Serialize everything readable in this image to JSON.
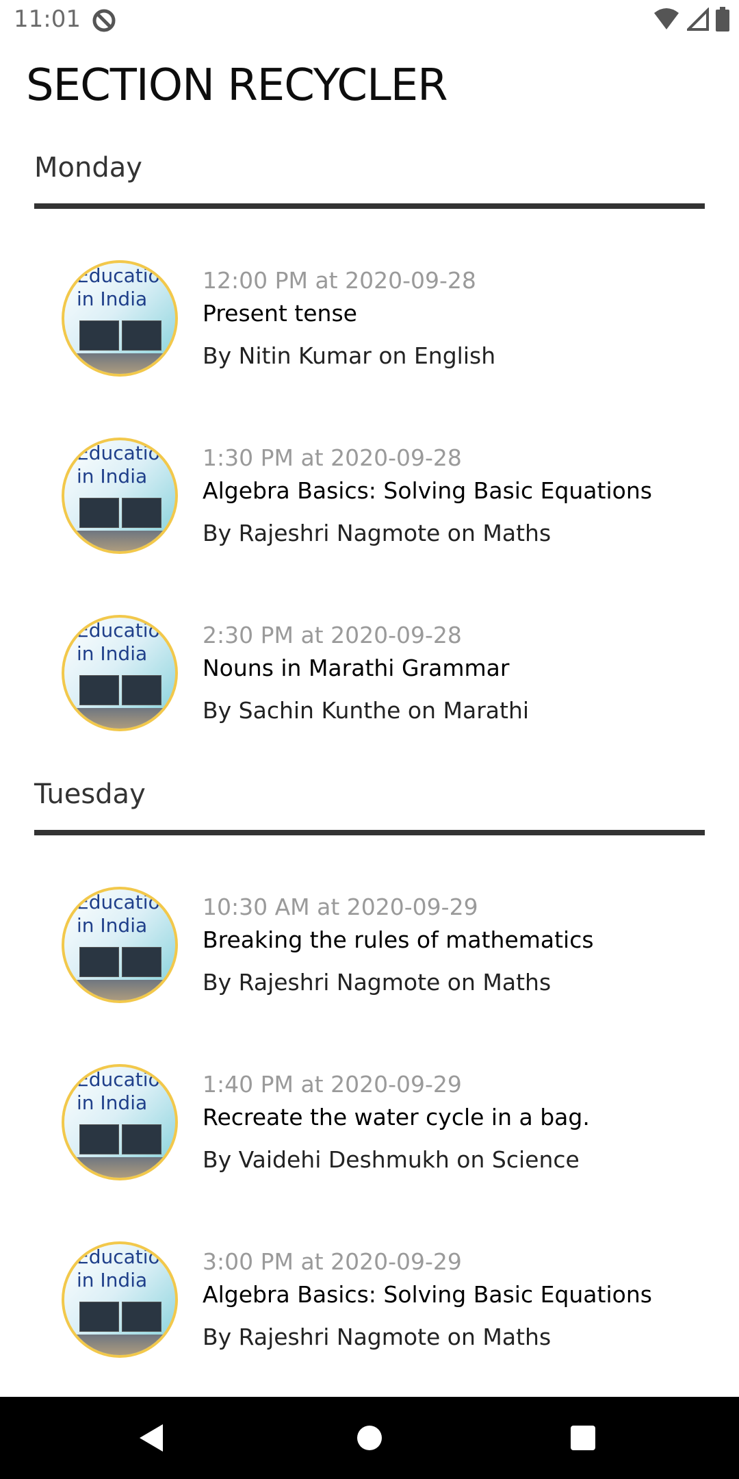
{
  "status_bar": {
    "time": "11:01"
  },
  "page": {
    "title": "SECTION RECYCLER"
  },
  "thumbnail": {
    "line1": "Educatio",
    "line2": "in India"
  },
  "sections": [
    {
      "header": "Monday",
      "items": [
        {
          "time": "12:00 PM at 2020-09-28",
          "title": "Present tense",
          "sub": "By Nitin Kumar on English"
        },
        {
          "time": "1:30 PM at 2020-09-28",
          "title": "Algebra Basics: Solving Basic Equations",
          "sub": "By Rajeshri Nagmote on Maths"
        },
        {
          "time": "2:30 PM at 2020-09-28",
          "title": "Nouns in Marathi Grammar",
          "sub": "By Sachin Kunthe on Marathi"
        }
      ]
    },
    {
      "header": "Tuesday",
      "items": [
        {
          "time": "10:30 AM at 2020-09-29",
          "title": "Breaking the rules of mathematics",
          "sub": "By Rajeshri Nagmote on Maths"
        },
        {
          "time": "1:40 PM at 2020-09-29",
          "title": "Recreate the water cycle in a bag.",
          "sub": "By Vaidehi Deshmukh on Science"
        },
        {
          "time": "3:00 PM at 2020-09-29",
          "title": "Algebra Basics: Solving Basic Equations",
          "sub": "By Rajeshri Nagmote on Maths"
        }
      ]
    }
  ],
  "nav": {
    "back_icon": "back-icon",
    "home_icon": "home-icon",
    "recents_icon": "recents-icon"
  }
}
